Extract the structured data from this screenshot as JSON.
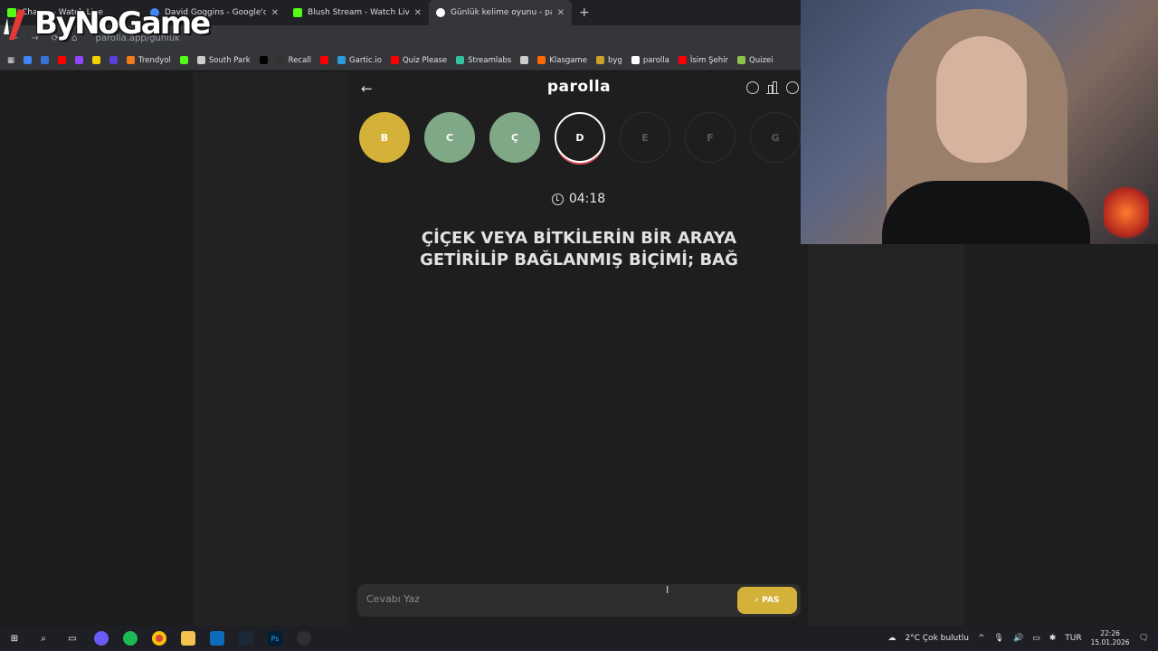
{
  "browser": {
    "tabs": [
      {
        "title": "Chan... - Watch Live",
        "favicon_color": "#53fc18"
      },
      {
        "title": "David Goggins - Google'da Ara",
        "favicon_color": "#4285f4"
      },
      {
        "title": "Blush Stream - Watch Live on K",
        "favicon_color": "#53fc18"
      },
      {
        "title": "Günlük kelime oyunu - parolla",
        "favicon_color": "#ffffff"
      }
    ],
    "new_tab": "+",
    "close": "✕",
    "url": "parolla.app/gunluk",
    "bookmarks": [
      {
        "label": "",
        "color": "#4285f4"
      },
      {
        "label": "",
        "color": "#3b6fd8"
      },
      {
        "label": "",
        "color": "#ff0000"
      },
      {
        "label": "",
        "color": "#9146ff"
      },
      {
        "label": "",
        "color": "#f5d000"
      },
      {
        "label": "",
        "color": "#5a3fd8"
      },
      {
        "label": "Trendyol",
        "color": "#f27a1a"
      },
      {
        "label": "",
        "color": "#53fc18"
      },
      {
        "label": "South Park",
        "color": "#cccccc"
      },
      {
        "label": "",
        "color": "#000000"
      },
      {
        "label": "Recall",
        "color": "#333333"
      },
      {
        "label": "",
        "color": "#ff0000"
      },
      {
        "label": "Gartic.io",
        "color": "#2b9ad6"
      },
      {
        "label": "Quiz Please",
        "color": "#ff0000"
      },
      {
        "label": "Streamlabs",
        "color": "#31c3a2"
      },
      {
        "label": "",
        "color": "#cccccc"
      },
      {
        "label": "Klasgame",
        "color": "#ff6a00"
      },
      {
        "label": "byg",
        "color": "#c9a227"
      },
      {
        "label": "parolla",
        "color": "#ffffff"
      },
      {
        "label": "İsim Şehir",
        "color": "#ff0000"
      },
      {
        "label": "Quizei",
        "color": "#8bc34a"
      }
    ]
  },
  "overlay": {
    "logo_text": "ByNoGame"
  },
  "app": {
    "brand": "parolla",
    "back_icon": "←",
    "letters": [
      {
        "letter": "B",
        "state": "yellow",
        "bg": "#d4b23a",
        "fg": "#ffffff"
      },
      {
        "letter": "C",
        "state": "green",
        "bg": "#7fa886",
        "fg": "#ffffff"
      },
      {
        "letter": "Ç",
        "state": "green",
        "bg": "#7fa886",
        "fg": "#ffffff"
      },
      {
        "letter": "D",
        "state": "active",
        "bg": "#1e1e1e",
        "fg": "#ffffff"
      },
      {
        "letter": "E",
        "state": "pending",
        "bg": "#1e1e1e",
        "fg": "#5a5a5a"
      },
      {
        "letter": "F",
        "state": "pending",
        "bg": "#1e1e1e",
        "fg": "#5a5a5a"
      },
      {
        "letter": "G",
        "state": "pending",
        "bg": "#1e1e1e",
        "fg": "#5a5a5a"
      }
    ],
    "timer": "04:18",
    "question_line1": "ÇİÇEK VEYA BİTKİLERİN BİR ARAYA",
    "question_line2": "GETİRİLİP BAĞLANMIŞ BİÇİMİ; BAĞ",
    "answer_placeholder": "Cevabı Yaz",
    "answer_value": "",
    "pass_label": "PAS",
    "pass_icon": "›",
    "accent_yellow": "#d4b23a",
    "accent_green": "#7fa886"
  },
  "taskbar": {
    "weather": "2°C  Çok bulutlu",
    "language": "TUR",
    "time": "22:26",
    "date": "15.01.2026"
  }
}
